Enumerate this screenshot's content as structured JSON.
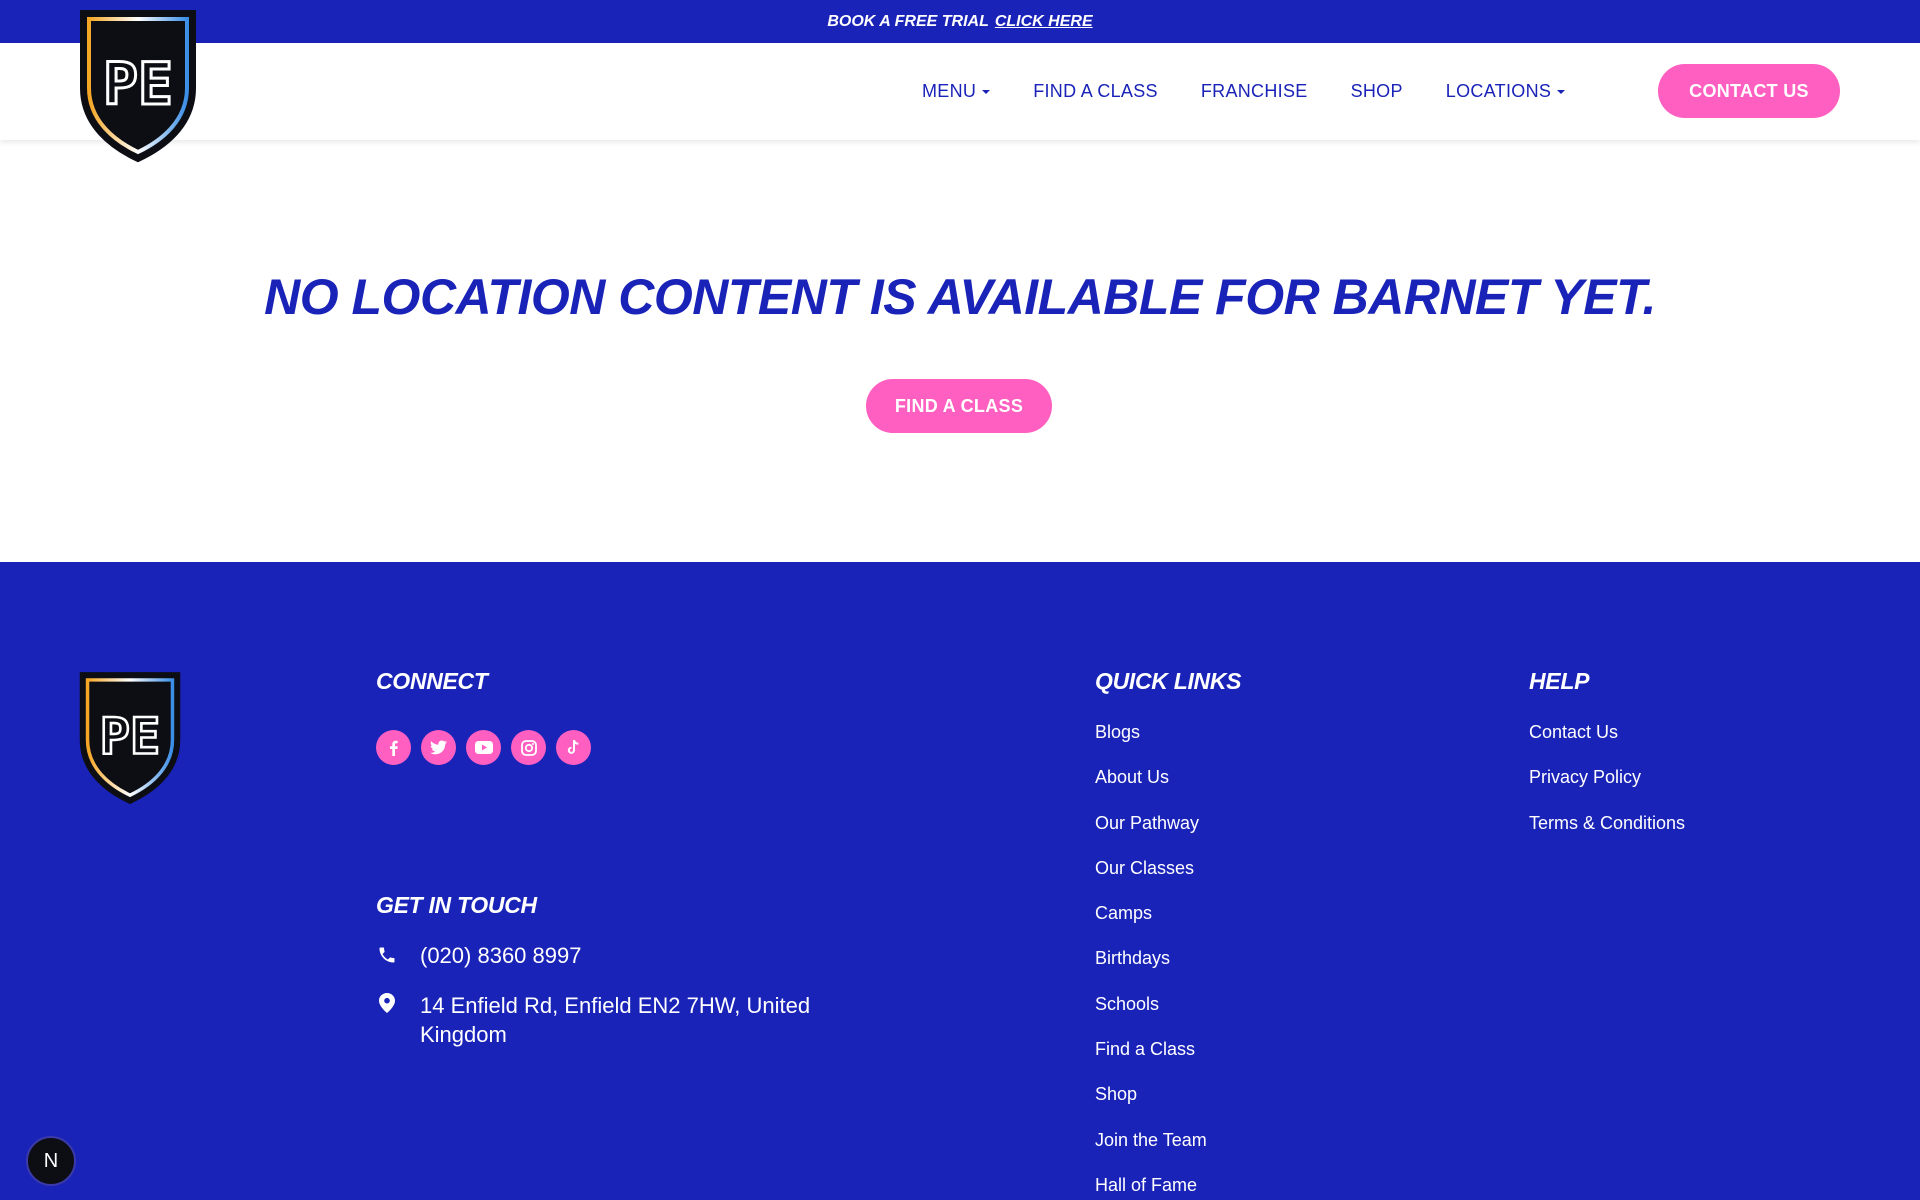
{
  "promo": {
    "text": "BOOK A FREE TRIAL",
    "link": "CLICK HERE"
  },
  "logo": {
    "letters": "PE"
  },
  "nav": {
    "items": [
      {
        "label": "MENU",
        "has_dropdown": true
      },
      {
        "label": "FIND A CLASS",
        "has_dropdown": false
      },
      {
        "label": "FRANCHISE",
        "has_dropdown": false
      },
      {
        "label": "SHOP",
        "has_dropdown": false
      },
      {
        "label": "LOCATIONS",
        "has_dropdown": true
      }
    ],
    "contact_button": "CONTACT US"
  },
  "main": {
    "headline": "NO LOCATION CONTENT IS AVAILABLE FOR BARNET YET.",
    "button": "FIND A CLASS"
  },
  "footer": {
    "connect": {
      "heading": "CONNECT",
      "socials": [
        "facebook-icon",
        "twitter-icon",
        "youtube-icon",
        "instagram-icon",
        "tiktok-icon"
      ]
    },
    "get_in_touch": {
      "heading": "GET IN TOUCH",
      "phone": "(020) 8360 8997",
      "address": "14 Enfield Rd, Enfield EN2 7HW, United Kingdom"
    },
    "quick_links": {
      "heading": "QUICK LINKS",
      "links": [
        "Blogs",
        "About Us",
        "Our Pathway",
        "Our Classes",
        "Camps",
        "Birthdays",
        "Schools",
        "Find a Class",
        "Shop",
        "Join the Team",
        "Hall of Fame"
      ]
    },
    "help": {
      "heading": "HELP",
      "links": [
        "Contact Us",
        "Privacy Policy",
        "Terms & Conditions"
      ]
    }
  },
  "badge": "N",
  "colors": {
    "brand_blue": "#1a23b8",
    "accent_pink": "#ff5fc0",
    "white": "#ffffff",
    "black": "#0d0d14"
  }
}
